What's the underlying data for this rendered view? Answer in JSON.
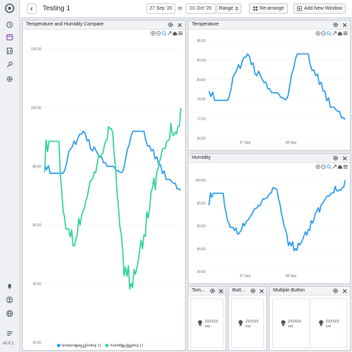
{
  "app": {
    "title": "Testing 1",
    "version": "v0.0.1"
  },
  "toolbar": {
    "start_date": "27 Sep '20",
    "to_label": "to",
    "end_date": "01 Oct '20",
    "range_label": "Range",
    "rearrange_label": "Re-arrange",
    "add_window_label": "Add New Window"
  },
  "sidebar": {
    "top_icons": [
      "logo-icon",
      "dashboard-icon",
      "calendar-icon",
      "report-icon",
      "key-icon",
      "settings-icon"
    ],
    "bottom_icons": [
      "bell-icon",
      "user-icon",
      "globe-icon",
      "menu-icon"
    ]
  },
  "colors": {
    "temperature": "#2d9bee",
    "humidity": "#2ed39a",
    "accent": "#2d9bee"
  },
  "panels": {
    "compare": {
      "title": "Temperature and Humidity Compare"
    },
    "temperature": {
      "title": "Temperature"
    },
    "humidity": {
      "title": "Humidity"
    },
    "small1": {
      "title": "Tom...",
      "line1": "ZXZXZX",
      "line2": "zxz"
    },
    "small2": {
      "title": "Butt...",
      "line1": "ZXZXZX",
      "line2": "zxz"
    },
    "multi": {
      "title": "Multiple Button",
      "buttons": [
        {
          "line1": "ZXZXZX",
          "line2": "zxz"
        },
        {
          "line1": "ZXZXZX",
          "line2": "zxz"
        }
      ]
    }
  },
  "chart_data": [
    {
      "type": "line",
      "title": "Temperature and Humidity Compare",
      "x_ticks": [
        "27 Sep",
        "28 Sep"
      ],
      "ylim": [
        20,
        120
      ],
      "y_ticks": [
        "20.00",
        "40.00",
        "60.00",
        "80.00",
        "100.00",
        "120.00"
      ],
      "y_tick_values": [
        20,
        40,
        60,
        80,
        100,
        120
      ],
      "legend_position": "bottom",
      "series": [
        {
          "name": "temperature (Testing 1)",
          "values": [
            80.5,
            78.8,
            80.2,
            77.6,
            77.6,
            77.6,
            77.6,
            77.6,
            77.6,
            77.6,
            77.6,
            78.8,
            81.2,
            84.8,
            85.8,
            86.7,
            88.6,
            87.4,
            89.4,
            90.9,
            90.9,
            91.9,
            91.2,
            88.6,
            89.1,
            85.8,
            85.2,
            86.6,
            85.2,
            84.0,
            83.1,
            83.2,
            81.2,
            81.2,
            80.0,
            80.0,
            79.9,
            80.0,
            79.5,
            78.5,
            78.5,
            77.9,
            77.9,
            79.1,
            82.5,
            85.8,
            87.4,
            90.4,
            91.9,
            91.9,
            91.9,
            91.9,
            91.9,
            91.9,
            91.9,
            88.6,
            86.9,
            87.0,
            85.2,
            85.7,
            82.5,
            83.2,
            80.5,
            80.5,
            77.5,
            78.4,
            75.5,
            75.5,
            75.5,
            74.8,
            74.2,
            74.2,
            72.3,
            72.3,
            71.8
          ]
        },
        {
          "name": "humidity (Testing 1)",
          "values": [
            78.0,
            89.0,
            85.0,
            88.5,
            88.5,
            88.5,
            88.5,
            88.5,
            88.5,
            88.5,
            88.5,
            77.6,
            71.6,
            64.8,
            62.6,
            58.6,
            58.6,
            58.6,
            55.9,
            58.3,
            52.9,
            52.9,
            55.1,
            56.8,
            62.3,
            60.0,
            63.1,
            64.7,
            65.7,
            68.1,
            69.6,
            72.2,
            74.8,
            75.3,
            75.8,
            78.0,
            77.8,
            80.6,
            83.7,
            83.3,
            84.0,
            84.4,
            86.8,
            88.6,
            88.9,
            93.5,
            92.8,
            92.8,
            91.4,
            84.0,
            79.4,
            71.5,
            66.2,
            59.5,
            56.8,
            51.5,
            42.7,
            45.7,
            42.5,
            46.1,
            38.2,
            40.1,
            38.6,
            44.9,
            43.2,
            45.3,
            48.0,
            51.4,
            54.8,
            51.9,
            56.7,
            56.1,
            64.5,
            62.4,
            65.5,
            71.0,
            72.7,
            76.0,
            72.0,
            78.1,
            79.3,
            81.6,
            83.3,
            85.8,
            86.1,
            86.1,
            88.4,
            88.7,
            89.1,
            94.6,
            90.8,
            90.5,
            91.6,
            91.1,
            93.6,
            93.7,
            99.8
          ]
        }
      ]
    },
    {
      "type": "line",
      "title": "Temperature",
      "x_ticks": [
        "27 Sep",
        "28 Sep"
      ],
      "ylim": [
        66,
        96
      ],
      "y_ticks": [
        "66.00",
        "72.00",
        "78.00",
        "84.00",
        "90.00",
        "96.00"
      ],
      "y_tick_values": [
        66,
        72,
        78,
        84,
        90,
        96
      ],
      "series": [
        {
          "name": "Temperature",
          "values": [
            80.5,
            78.8,
            80.2,
            77.6,
            77.6,
            77.6,
            77.6,
            77.6,
            77.6,
            77.6,
            77.6,
            78.8,
            81.2,
            84.8,
            85.8,
            86.7,
            88.6,
            87.4,
            89.4,
            90.9,
            90.9,
            91.9,
            91.2,
            88.6,
            89.1,
            85.8,
            85.2,
            86.6,
            85.2,
            84.0,
            83.1,
            83.2,
            81.2,
            81.2,
            80.0,
            80.0,
            79.9,
            80.0,
            79.5,
            78.5,
            78.5,
            77.9,
            77.9,
            79.1,
            82.5,
            85.8,
            87.4,
            90.4,
            91.9,
            91.9,
            91.9,
            91.9,
            91.9,
            91.9,
            91.9,
            88.6,
            86.9,
            87.0,
            85.2,
            85.7,
            82.5,
            83.2,
            80.5,
            80.5,
            77.5,
            78.4,
            75.5,
            75.5,
            75.5,
            74.8,
            74.2,
            74.2,
            72.3,
            72.3,
            71.8
          ]
        }
      ]
    },
    {
      "type": "line",
      "title": "Humidity",
      "x_ticks": [
        "27 Sep",
        "28 Sep"
      ],
      "ylim": [
        20,
        100
      ],
      "y_ticks": [
        "20.00",
        "40.00",
        "60.00",
        "80.00",
        "100.00"
      ],
      "y_tick_values": [
        20,
        40,
        60,
        80,
        100
      ],
      "series": [
        {
          "name": "Humidity",
          "values": [
            78.0,
            89.0,
            85.0,
            88.5,
            88.5,
            88.5,
            88.5,
            88.5,
            88.5,
            88.5,
            88.5,
            77.6,
            71.6,
            64.8,
            62.6,
            58.6,
            58.6,
            58.6,
            55.9,
            58.3,
            52.9,
            52.9,
            55.1,
            56.8,
            62.3,
            60.0,
            63.1,
            64.7,
            65.7,
            68.1,
            69.6,
            72.2,
            74.8,
            75.3,
            75.8,
            78.0,
            77.8,
            80.6,
            83.7,
            83.3,
            84.0,
            84.4,
            86.8,
            88.6,
            88.9,
            93.5,
            92.8,
            92.8,
            91.4,
            84.0,
            79.4,
            71.5,
            66.2,
            59.5,
            56.8,
            51.5,
            42.7,
            45.7,
            42.5,
            46.1,
            38.2,
            40.1,
            38.6,
            44.9,
            43.2,
            45.3,
            48.0,
            51.4,
            54.8,
            51.9,
            56.7,
            56.1,
            64.5,
            62.4,
            65.5,
            71.0,
            72.7,
            76.0,
            72.0,
            78.1,
            79.3,
            81.6,
            83.3,
            85.8,
            86.1,
            86.1,
            88.4,
            88.7,
            89.1,
            94.6,
            90.8,
            90.5,
            91.6,
            91.1,
            93.6,
            93.7,
            99.8
          ]
        }
      ]
    }
  ]
}
